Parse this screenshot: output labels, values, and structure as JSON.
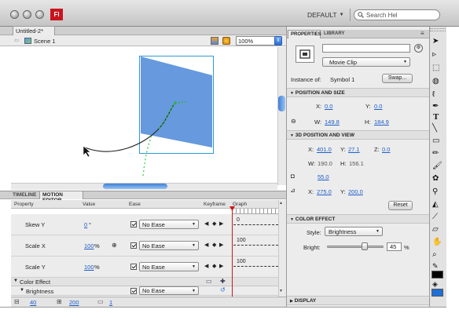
{
  "window": {
    "app_icon_label": "Fl",
    "workspace": "DEFAULT",
    "search_placeholder": "Search Hel"
  },
  "doc": {
    "tab_label": "Untitled-2*",
    "scene_label": "Scene 1",
    "zoom": "100%"
  },
  "timeline": {
    "tabs": [
      "TIMELINE",
      "MOTION EDITOR"
    ],
    "headers": {
      "property": "Property",
      "value": "Value",
      "ease": "Ease",
      "keyframe": "Keyframe",
      "graph": "Graph"
    },
    "rows": [
      {
        "name": "Skew Y",
        "value": "0",
        "unit": "°",
        "ease": "No Ease",
        "graph": "0"
      },
      {
        "name": "Scale X",
        "value": "100",
        "unit": "%",
        "ease": "No Ease",
        "graph": "100"
      },
      {
        "name": "Scale Y",
        "value": "100",
        "unit": "%",
        "ease": "No Ease",
        "graph": "100"
      },
      {
        "name": "Color Effect"
      },
      {
        "name": "Brightness",
        "ease": "No Ease"
      }
    ],
    "footer": {
      "v1": "40",
      "v2": "200",
      "v3": "1"
    }
  },
  "properties": {
    "tabs": [
      "PROPERTIES",
      "LIBRARY"
    ],
    "symbol_type": "Movie Clip",
    "instance_label": "Instance of:",
    "instance_name": "Symbol 1",
    "swap_label": "Swap...",
    "pos_size": {
      "title": "POSITION AND SIZE",
      "x_label": "X:",
      "x": "0.0",
      "y_label": "Y:",
      "y": "0.0",
      "w_label": "W:",
      "w": "149.8",
      "h_label": "H:",
      "h": "184.9"
    },
    "pos3d": {
      "title": "3D POSITION AND VIEW",
      "x_label": "X:",
      "x": "401.0",
      "y_label": "Y:",
      "y": "27.1",
      "z_label": "Z:",
      "z": "0.0",
      "w_label": "W:",
      "w": "190.0",
      "h_label": "H:",
      "h": "156.1",
      "persp": "55.0",
      "vx_label": "X:",
      "vx": "275.0",
      "vy_label": "Y:",
      "vy": "200.0",
      "reset_label": "Reset"
    },
    "color_effect": {
      "title": "COLOR EFFECT",
      "style_label": "Style:",
      "style": "Brightness",
      "bright_label": "Bright:",
      "bright": "45",
      "bright_unit": "%",
      "bright_level": 0.45
    },
    "display_title": "DISPLAY"
  }
}
